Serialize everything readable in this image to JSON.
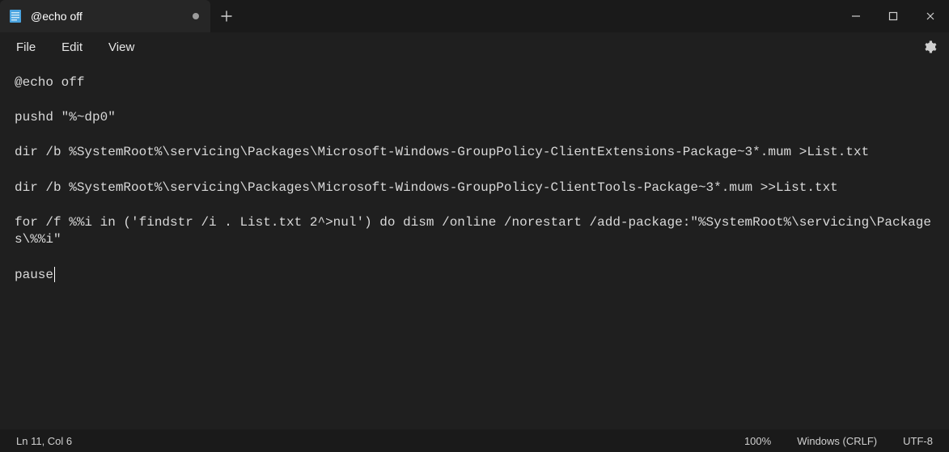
{
  "tab": {
    "title": "@echo off"
  },
  "menu": {
    "file": "File",
    "edit": "Edit",
    "view": "View"
  },
  "editor": {
    "lines": [
      "@echo off",
      "",
      "pushd \"%~dp0\"",
      "",
      "dir /b %SystemRoot%\\servicing\\Packages\\Microsoft-Windows-GroupPolicy-ClientExtensions-Package~3*.mum >List.txt",
      "",
      "dir /b %SystemRoot%\\servicing\\Packages\\Microsoft-Windows-GroupPolicy-ClientTools-Package~3*.mum >>List.txt",
      "",
      "for /f %%i in ('findstr /i . List.txt 2^>nul') do dism /online /norestart /add-package:\"%SystemRoot%\\servicing\\Packages\\%%i\"",
      "",
      "pause"
    ],
    "caret_line_index": 10
  },
  "status": {
    "position": "Ln 11, Col 6",
    "zoom": "100%",
    "eol": "Windows (CRLF)",
    "encoding": "UTF-8"
  }
}
